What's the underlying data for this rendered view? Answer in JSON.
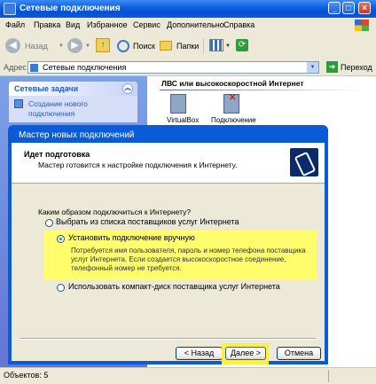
{
  "window": {
    "title": "Сетевые подключения"
  },
  "menu": [
    "Файл",
    "Правка",
    "Вид",
    "Избранное",
    "Сервис",
    "Дополнительно",
    "Справка"
  ],
  "toolbar": {
    "back": "Назад",
    "search": "Поиск",
    "folders": "Папки"
  },
  "address": {
    "label": "Адрес",
    "value": "Сетевые подключения",
    "go": "Переход"
  },
  "left": {
    "tasks_header": "Сетевые задачи",
    "task1_line1": "Создание нового",
    "task1_line2": "подключения"
  },
  "right": {
    "section": "ЛВС или высокоскоростной Интернет",
    "item1": "VirtualBox",
    "item2": "Подключение"
  },
  "status": {
    "objects": "Объектов: 5"
  },
  "dialog": {
    "title": "Мастер новых подключений",
    "header_title": "Идет подготовка",
    "header_sub": "Мастер готовится к настройке подключения к Интернету.",
    "question": "Каким образом подключиться к Интернету?",
    "opt1": "Выбрать из списка поставщиков услуг Интернета",
    "opt2": "Установить подключение вручную",
    "opt2_desc": "Потребуется имя пользователя, пароль и номер телефона поставщика услуг Интернета. Если создается высокоскоростное соединение, телефонный номер не требуется.",
    "opt3": "Использовать компакт-диск поставщика услуг Интернета",
    "back": "< Назад",
    "next": "Далее >",
    "cancel": "Отмена"
  }
}
